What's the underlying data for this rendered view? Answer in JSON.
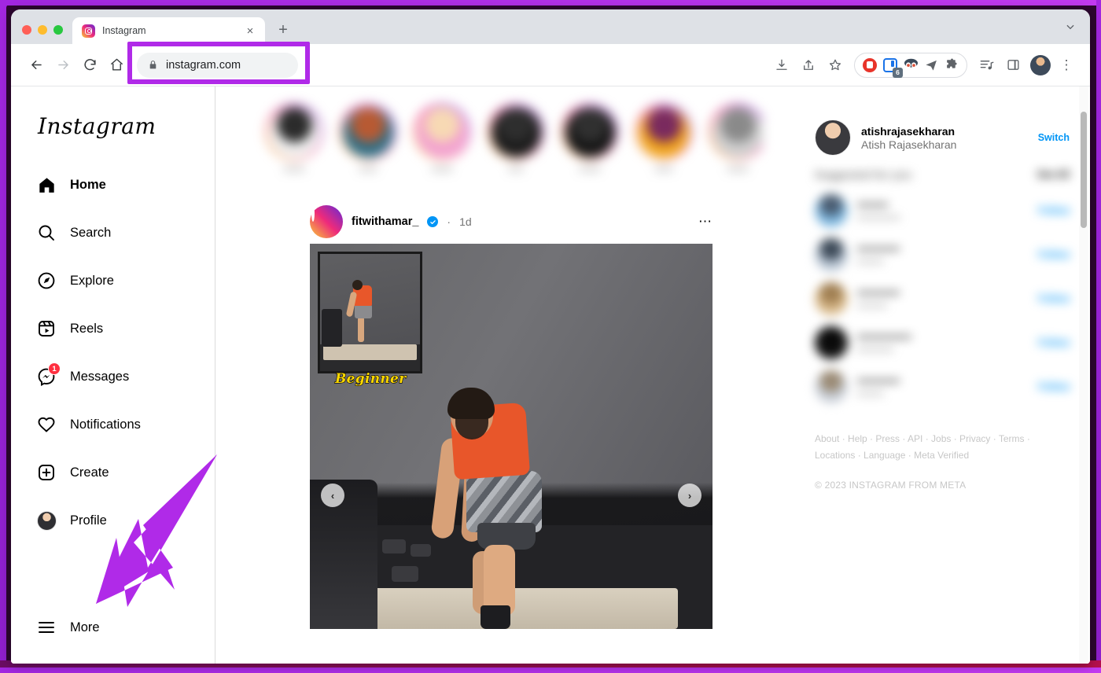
{
  "browser": {
    "tab": {
      "title": "Instagram",
      "favicon": "instagram-favicon",
      "close": "×"
    },
    "new_tab": "+",
    "tab_list_chevron": "⌄",
    "nav": {
      "back": "←",
      "forward": "→",
      "reload": "↻",
      "home": "⌂"
    },
    "address": {
      "value": "instagram.com",
      "lock": "lock-icon"
    },
    "toolbar_icons": [
      "downloads-icon",
      "share-icon",
      "bookmark-star-icon",
      "adblock-extension-icon",
      "tab-manager-extension-icon",
      "grammarly-extension-icon",
      "paperplane-extension-icon",
      "extensions-puzzle-icon",
      "reading-list-icon",
      "side-panel-icon"
    ],
    "tab_manager_badge": "6",
    "profile_avatar": "browser-profile-avatar",
    "menu": "⋮"
  },
  "instagram": {
    "logo": "Instagram",
    "nav": [
      {
        "label": "Home",
        "icon": "home-icon",
        "active": true,
        "badge": null
      },
      {
        "label": "Search",
        "icon": "search-icon",
        "active": false,
        "badge": null
      },
      {
        "label": "Explore",
        "icon": "compass-icon",
        "active": false,
        "badge": null
      },
      {
        "label": "Reels",
        "icon": "reels-icon",
        "active": false,
        "badge": null
      },
      {
        "label": "Messages",
        "icon": "messenger-icon",
        "active": false,
        "badge": "1"
      },
      {
        "label": "Notifications",
        "icon": "heart-icon",
        "active": false,
        "badge": null
      },
      {
        "label": "Create",
        "icon": "plus-square-icon",
        "active": false,
        "badge": null
      },
      {
        "label": "Profile",
        "icon": "profile-avatar-icon",
        "active": false,
        "badge": null
      }
    ],
    "more": {
      "label": "More",
      "icon": "hamburger-icon"
    },
    "stories": [
      {
        "name": "•••••••",
        "color1": "#efefef",
        "color2": "#2b2b2b"
      },
      {
        "name": "••••••",
        "color1": "#2f6f86",
        "color2": "#b75a33"
      },
      {
        "name": "•••••••",
        "color1": "#f2a0d0",
        "color2": "#f7d9b4"
      },
      {
        "name": "•••••",
        "color1": "#1a1a1a",
        "color2": "#2e2e2e"
      },
      {
        "name": "•••••••",
        "color1": "#141414",
        "color2": "#303030"
      },
      {
        "name": "••••••",
        "color1": "#f0a41c",
        "color2": "#7a2a5e"
      },
      {
        "name": "•••••••",
        "color1": "#cfcfcf",
        "color2": "#8a8a8a"
      },
      {
        "name": "••••••",
        "color1": "#6e2a22",
        "color2": "#d7d2cd"
      }
    ],
    "post": {
      "username": "fitwithamar_",
      "verified_badge": "✓",
      "separator": "·",
      "time": "1d",
      "more_options": "⋯",
      "media_overlay_label": "Beginner",
      "carousel_prev": "‹",
      "carousel_next": "›"
    },
    "right_rail": {
      "username": "atishrajasekharan",
      "fullname": "Atish Rajasekharan",
      "switch_label": "Switch",
      "suggestions_title": "Suggested for you",
      "see_all_label": "See All",
      "suggestions": [
        {
          "user": "••••••••",
          "sub": "•••••••••••••",
          "action": "Follow",
          "c1": "#7fb8e0",
          "c2": "#4a5d72"
        },
        {
          "user": "•••••••••••",
          "sub": "••••••••",
          "action": "Follow",
          "c1": "#b9c6d4",
          "c2": "#3d4a58"
        },
        {
          "user": "•••••••••••",
          "sub": "•••••••••",
          "action": "Follow",
          "c1": "#d8b98a",
          "c2": "#a07f52"
        },
        {
          "user": "••••••••••••••",
          "sub": "•••••••••••",
          "action": "Follow",
          "c1": "#101010",
          "c2": "#0a0a0a"
        },
        {
          "user": "•••••••••••",
          "sub": "••••••••",
          "action": "Follow",
          "c1": "#c9cfd8",
          "c2": "#9a8a74"
        }
      ],
      "footer_links": "About · Help · Press · API · Jobs · Privacy · Terms · Locations · Language · Meta Verified",
      "copyright": "© 2023 INSTAGRAM FROM META"
    }
  },
  "annotations": {
    "url_highlight_color": "#b02ae8",
    "arrow_color": "#b02ae8",
    "frame_color": "#a227e0"
  }
}
